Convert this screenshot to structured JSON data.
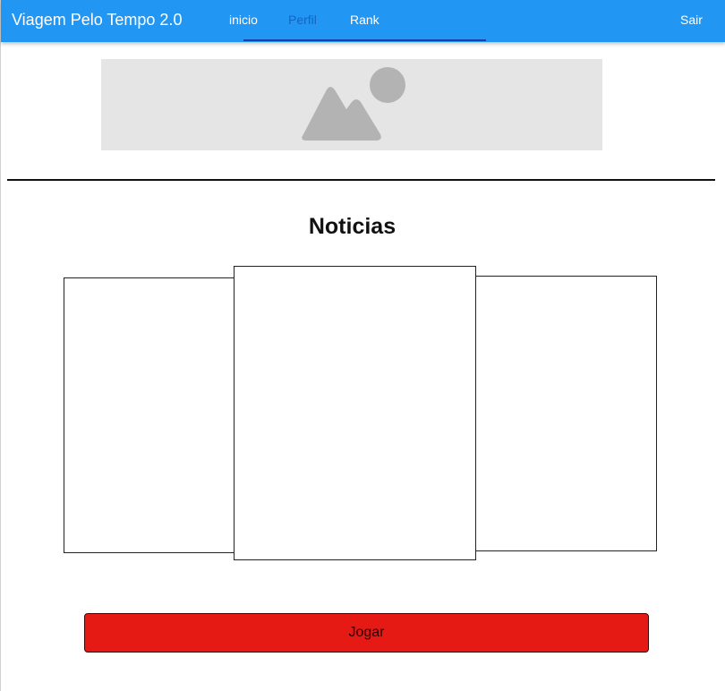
{
  "app_bar": {
    "title": "Viagem Pelo Tempo 2.0",
    "tabs": [
      {
        "label": "inicio",
        "active": false
      },
      {
        "label": "Perfil",
        "active": true
      },
      {
        "label": "Rank",
        "active": false
      }
    ],
    "logout_label": "Sair",
    "background_color": "#2196f3",
    "active_tab_color": "#1565c0"
  },
  "banner": {
    "icon": "image-placeholder-icon",
    "background_color": "#e5e5e5"
  },
  "news": {
    "title": "Noticias",
    "cards": [
      {
        "position": "left"
      },
      {
        "position": "center"
      },
      {
        "position": "right"
      }
    ]
  },
  "play_button": {
    "label": "Jogar",
    "color": "#e61a15"
  }
}
